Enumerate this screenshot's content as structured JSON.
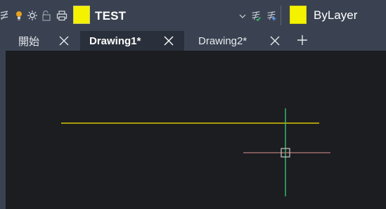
{
  "toolbar": {
    "layer_state_icons": [
      "layer-off-icon",
      "lightbulb-icon",
      "sun-freeze-icon",
      "lock-icon",
      "print-icon"
    ],
    "layer_color": "#f5f200",
    "layer_name": "TEST",
    "make_current_icon": "make-current-layer-icon",
    "match_layer_icon": "match-layer-icon",
    "color_swatch": "#f5f200",
    "color_label": "ByLayer"
  },
  "tabs": [
    {
      "label": "開始",
      "active": false
    },
    {
      "label": "Drawing1*",
      "active": true
    },
    {
      "label": "Drawing2*",
      "active": false
    }
  ],
  "new_tab_icon": "plus-icon",
  "canvas": {
    "background": "#1b1d21",
    "line_color": "#d9c400",
    "crosshair_vertical_color": "#3ccf6e",
    "crosshair_horizontal_color": "#b87b7b",
    "cursor_box_color": "#d6d6d6"
  }
}
